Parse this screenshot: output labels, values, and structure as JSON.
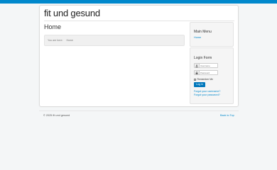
{
  "colors": {
    "accent": "#0088cc",
    "background": "#f4f6f7",
    "panel": "#ffffff",
    "button": "#0077bb"
  },
  "header": {
    "site_title": "fit und gesund"
  },
  "main": {
    "page_title": "Home",
    "breadcrumb": {
      "prefix": "You are here:",
      "current": "Home"
    }
  },
  "sidebar": {
    "main_menu": {
      "title": "Main Menu",
      "items": [
        {
          "label": "Home"
        }
      ]
    },
    "login_form": {
      "title": "Login Form",
      "username_placeholder": "Username",
      "password_placeholder": "Password",
      "username_icon": "user-icon",
      "password_icon": "lock-icon",
      "remember_label": "Remember Me",
      "login_button": "Log in",
      "forgot_username": "Forgot your username?",
      "forgot_password": "Forgot your password?"
    }
  },
  "footer": {
    "copyright": "© 2025 fit und gesund",
    "back_to_top": "Back to Top"
  }
}
